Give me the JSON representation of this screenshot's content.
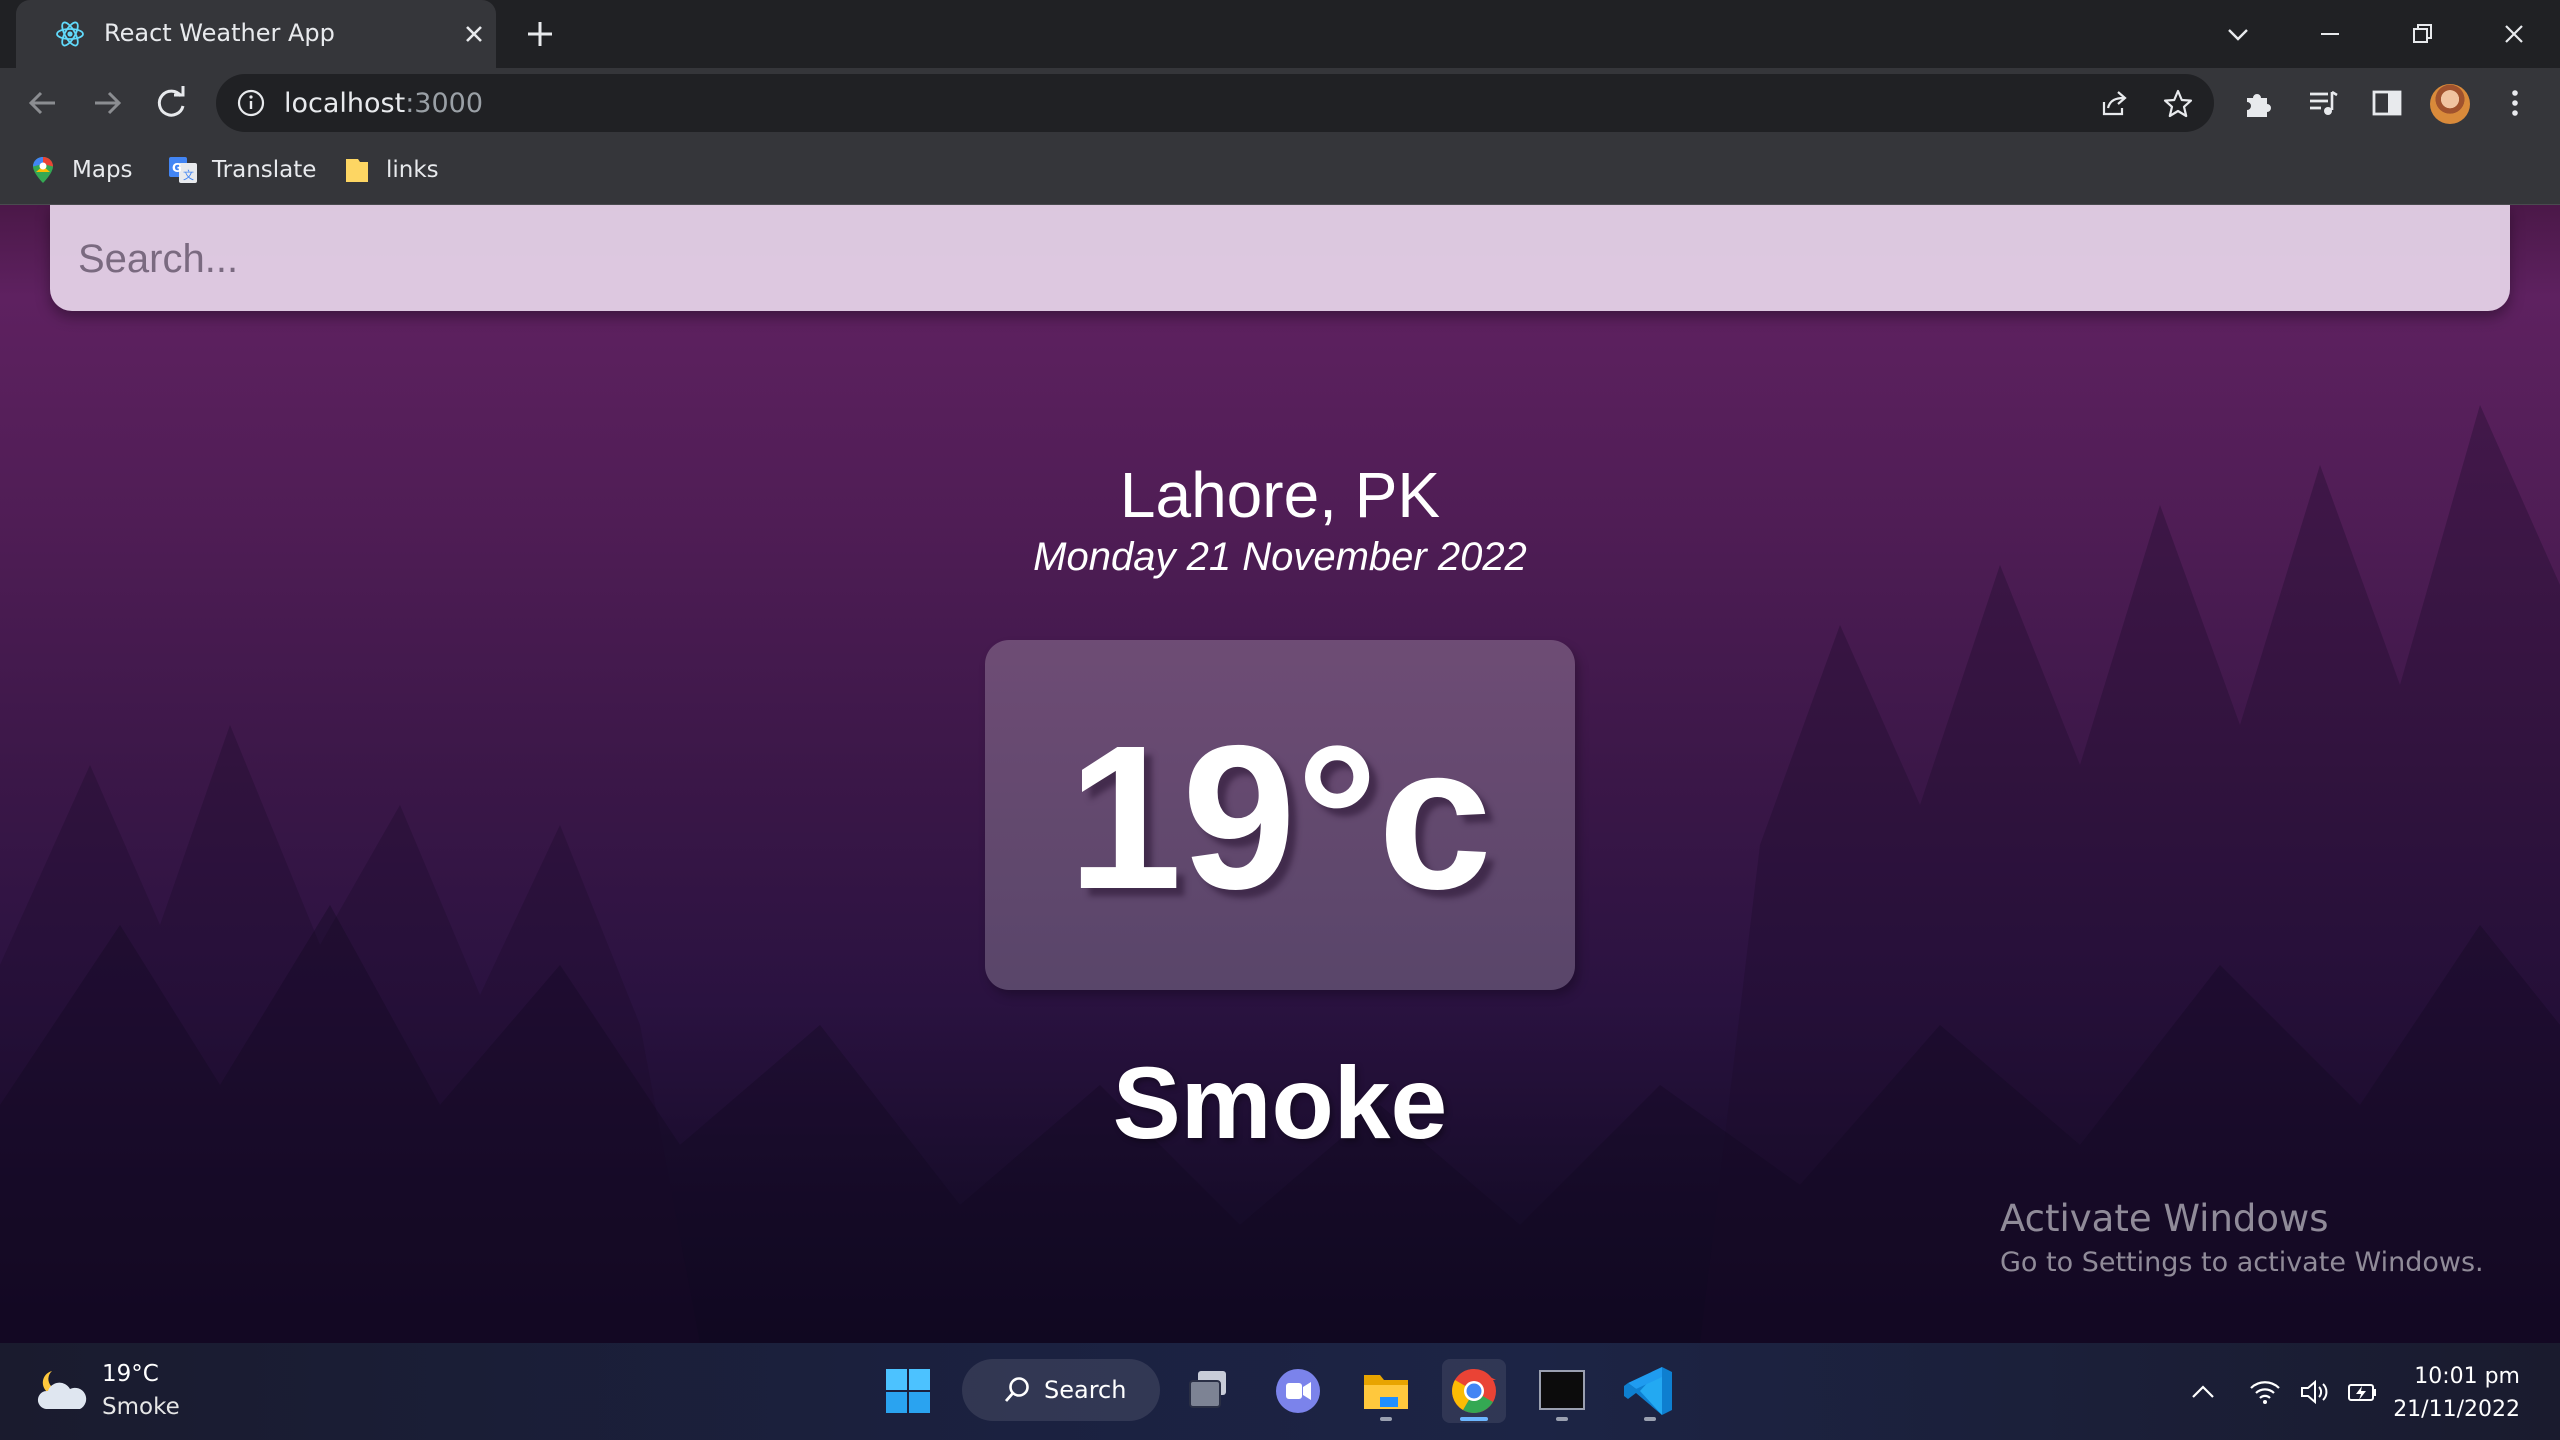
{
  "browser": {
    "tab_title": "React Weather App",
    "url_host": "localhost",
    "url_port": ":3000",
    "bookmarks": [
      {
        "label": "Maps",
        "icon": "maps-pin-icon"
      },
      {
        "label": "Translate",
        "icon": "translate-icon"
      },
      {
        "label": "links",
        "icon": "folder-icon"
      }
    ]
  },
  "app": {
    "search_placeholder": "Search...",
    "city": "Lahore, PK",
    "date": "Monday 21 November 2022",
    "temperature": "19°c",
    "condition": "Smoke"
  },
  "watermark": {
    "title": "Activate Windows",
    "subtitle": "Go to Settings to activate Windows."
  },
  "taskbar": {
    "weather_temp": "19°C",
    "weather_condition": "Smoke",
    "search_label": "Search",
    "time": "10:01 pm",
    "date": "21/11/2022"
  },
  "colors": {
    "page_top": "#5e2160",
    "page_bottom": "#100822",
    "search_bg": "#e8d7ec",
    "chrome_dark": "#202124",
    "chrome_toolbar": "#35363a"
  }
}
